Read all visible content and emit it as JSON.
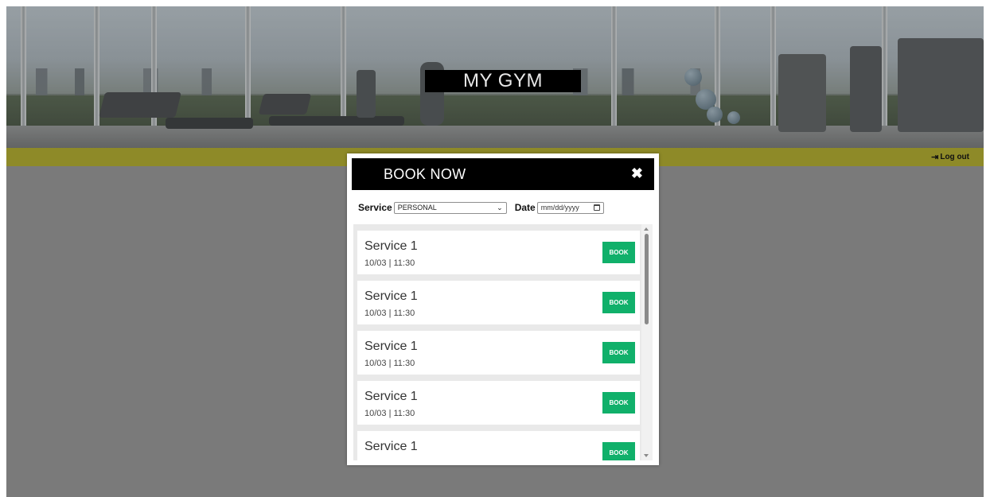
{
  "header": {
    "site_title": "MY GYM",
    "logout_label": "Log out",
    "logout_icon": "sign-out-icon",
    "nav_bar_color": "#8e8a28"
  },
  "modal": {
    "title": "BOOK NOW",
    "close_icon": "✖",
    "filters": {
      "service_label": "Service",
      "service_value": "PERSONAL",
      "date_label": "Date",
      "date_placeholder": "mm/dd/yyyy"
    },
    "items": [
      {
        "name": "Service 1",
        "time": "10/03 | 11:30",
        "button": "BOOK"
      },
      {
        "name": "Service 1",
        "time": "10/03 | 11:30",
        "button": "BOOK"
      },
      {
        "name": "Service 1",
        "time": "10/03 | 11:30",
        "button": "BOOK"
      },
      {
        "name": "Service 1",
        "time": "10/03 | 11:30",
        "button": "BOOK"
      },
      {
        "name": "Service 1",
        "time": "",
        "button": "BOOK"
      }
    ],
    "book_button_color": "#10b06a"
  }
}
